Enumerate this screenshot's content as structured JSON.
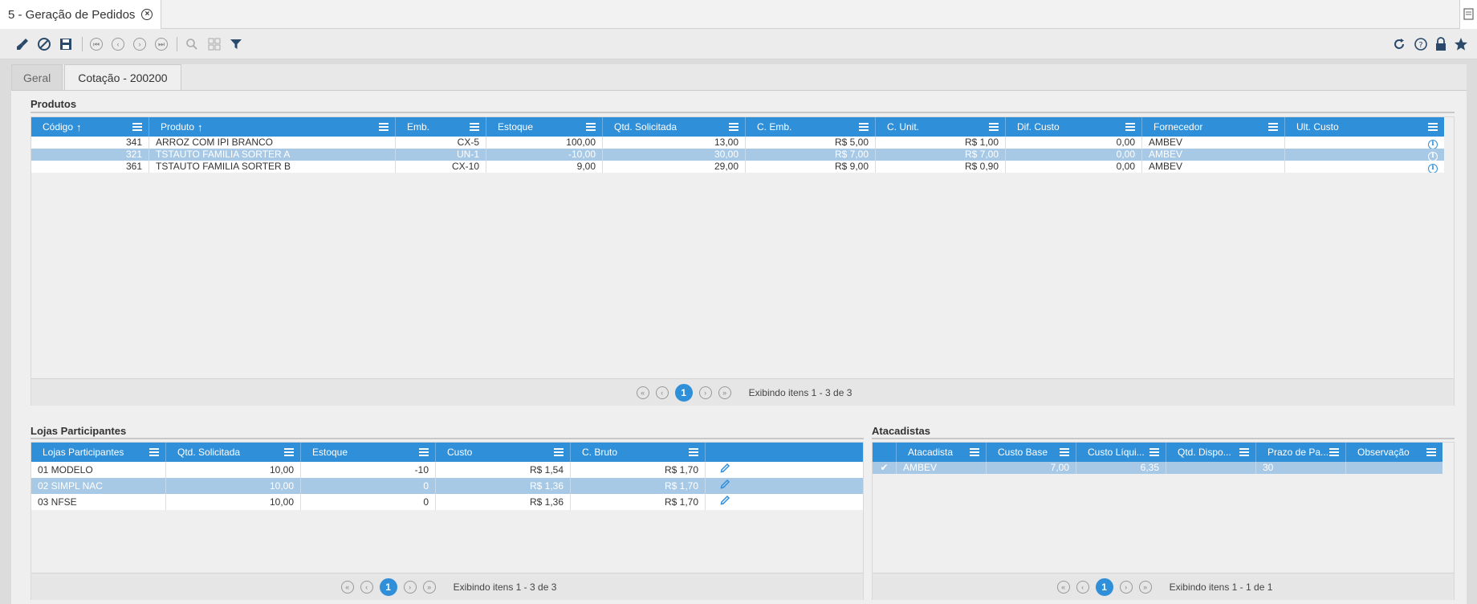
{
  "document_tab": {
    "title": "5 - Geração de Pedidos"
  },
  "tabs": [
    {
      "label": "Geral"
    },
    {
      "label": "Cotação - 200200"
    }
  ],
  "produtos": {
    "title": "Produtos",
    "columns": [
      "Código",
      "Produto",
      "Emb.",
      "Estoque",
      "Qtd. Solicitada",
      "C. Emb.",
      "C. Unit.",
      "Dif. Custo",
      "Fornecedor",
      "Ult. Custo"
    ],
    "rows": [
      [
        "341",
        "ARROZ COM IPI BRANCO",
        "CX-5",
        "100,00",
        "13,00",
        "R$ 5,00",
        "R$ 1,00",
        "0,00",
        "AMBEV"
      ],
      [
        "321",
        "TSTAUTO FAMILIA SORTER A",
        "UN-1",
        "-10,00",
        "30,00",
        "R$ 7,00",
        "R$ 7,00",
        "0,00",
        "AMBEV"
      ],
      [
        "361",
        "TSTAUTO FAMILIA SORTER B",
        "CX-10",
        "9,00",
        "29,00",
        "R$ 9,00",
        "R$ 0,90",
        "0,00",
        "AMBEV"
      ]
    ],
    "pager": {
      "page": "1",
      "info": "Exibindo itens 1 - 3 de 3"
    }
  },
  "lojas": {
    "title": "Lojas Participantes",
    "columns": [
      "Lojas Participantes",
      "Qtd. Solicitada",
      "Estoque",
      "Custo",
      "C. Bruto",
      ""
    ],
    "rows": [
      [
        "01 MODELO",
        "10,00",
        "-10",
        "R$ 1,54",
        "R$ 1,70"
      ],
      [
        "02 SIMPL NAC",
        "10,00",
        "0",
        "R$ 1,36",
        "R$ 1,70"
      ],
      [
        "03 NFSE",
        "10,00",
        "0",
        "R$ 1,36",
        "R$ 1,70"
      ]
    ],
    "pager": {
      "page": "1",
      "info": "Exibindo itens 1 - 3 de 3"
    }
  },
  "atacadistas": {
    "title": "Atacadistas",
    "columns": [
      "",
      "Atacadista",
      "Custo Base",
      "Custo Líqui...",
      "Qtd. Dispo...",
      "Prazo de Pa...",
      "Observação"
    ],
    "rows": [
      [
        "AMBEV",
        "7,00",
        "6,35",
        "",
        "30",
        ""
      ]
    ],
    "pager": {
      "page": "1",
      "info": "Exibindo itens 1 - 1 de 1"
    }
  },
  "colors": {
    "accent": "#2f8fd8",
    "selected_row": "#a7c9e6"
  }
}
